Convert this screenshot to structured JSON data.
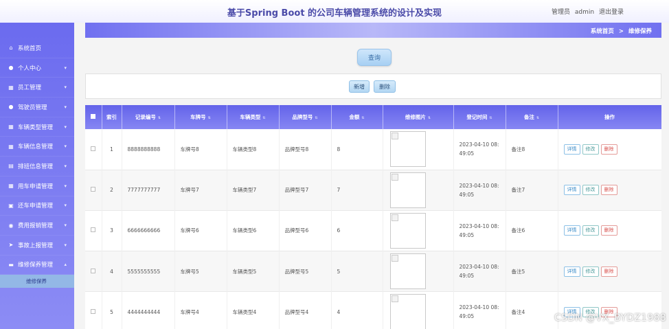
{
  "header": {
    "title": "基于Spring Boot 的公司车辆管理系统的设计及实现",
    "role": "管理员",
    "username": "admin",
    "logout": "退出登录"
  },
  "breadcrumb": {
    "home": "系统首页",
    "sep": ">",
    "current": "维修保养"
  },
  "sidebar": {
    "items": [
      {
        "label": "系统首页",
        "icon": "home-icon"
      },
      {
        "label": "个人中心",
        "icon": "user-icon"
      },
      {
        "label": "员工管理",
        "icon": "grid-icon"
      },
      {
        "label": "驾驶员管理",
        "icon": "user-icon"
      },
      {
        "label": "车辆类型管理",
        "icon": "grid-icon"
      },
      {
        "label": "车辆信息管理",
        "icon": "grid-icon"
      },
      {
        "label": "排班信息管理",
        "icon": "list-icon"
      },
      {
        "label": "用车申请管理",
        "icon": "grid-icon"
      },
      {
        "label": "还车申请管理",
        "icon": "briefcase-icon"
      },
      {
        "label": "费用报销管理",
        "icon": "pin-icon"
      },
      {
        "label": "事故上报管理",
        "icon": "send-icon"
      },
      {
        "label": "维修保养管理",
        "icon": "comment-icon"
      }
    ],
    "sub_item": "维修保养"
  },
  "toolbar": {
    "search": "查询",
    "add": "新增",
    "delete": "删除"
  },
  "table": {
    "headers": [
      "索引",
      "记录编号",
      "车牌号",
      "车辆类型",
      "品牌型号",
      "金额",
      "维修图片",
      "登记时间",
      "备注",
      "操作"
    ],
    "rows": [
      {
        "idx": "1",
        "code": "8888888888",
        "plate": "车牌号8",
        "type": "车辆类型8",
        "brand": "品牌型号8",
        "amount": "8",
        "time1": "2023-04-10 08:",
        "time2": "49:05",
        "note": "备注8"
      },
      {
        "idx": "2",
        "code": "7777777777",
        "plate": "车牌号7",
        "type": "车辆类型7",
        "brand": "品牌型号7",
        "amount": "7",
        "time1": "2023-04-10 08:",
        "time2": "49:05",
        "note": "备注7"
      },
      {
        "idx": "3",
        "code": "6666666666",
        "plate": "车牌号6",
        "type": "车辆类型6",
        "brand": "品牌型号6",
        "amount": "6",
        "time1": "2023-04-10 08:",
        "time2": "49:05",
        "note": "备注6"
      },
      {
        "idx": "4",
        "code": "5555555555",
        "plate": "车牌号5",
        "type": "车辆类型5",
        "brand": "品牌型号5",
        "amount": "5",
        "time1": "2023-04-10 08:",
        "time2": "49:05",
        "note": "备注5"
      },
      {
        "idx": "5",
        "code": "4444444444",
        "plate": "车牌号4",
        "type": "车辆类型4",
        "brand": "品牌型号4",
        "amount": "4",
        "time1": "2023-04-10 08:",
        "time2": "49:05",
        "note": "备注4"
      }
    ],
    "row_actions": {
      "detail": "详情",
      "edit": "修改",
      "delete": "删除"
    }
  },
  "watermark": "CSDN @VX_BYDZ1988",
  "colors": {
    "accent": "#6b6bef",
    "header_text": "#4a4aa8"
  }
}
